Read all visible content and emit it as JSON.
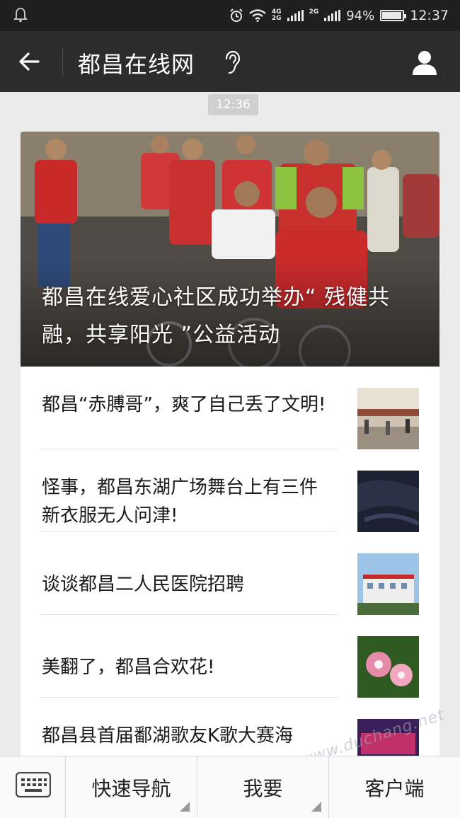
{
  "status_bar": {
    "network_top": "4G",
    "network_bottom": "2G",
    "network2": "2G",
    "battery_percent": "94%",
    "battery_level": 0.94,
    "time": "12:37",
    "icons": [
      "notification-bell-icon",
      "alarm-icon",
      "wifi-icon",
      "signal-icon",
      "battery-icon"
    ]
  },
  "header": {
    "title": "都昌在线网",
    "back_icon": "back-arrow-icon",
    "ear_icon": "ear-icon",
    "profile_icon": "profile-icon"
  },
  "timestamp": "12:36",
  "hero": {
    "title": "都昌在线爱心社区成功举办“ 残健共融，共享阳光 ”公益活动"
  },
  "articles": [
    {
      "title": "都昌“赤膊哥”，爽了自己丢了文明!"
    },
    {
      "title": "怪事，都昌东湖广场舞台上有三件新衣服无人问津!"
    },
    {
      "title": "谈谈都昌二人民医院招聘"
    },
    {
      "title": "美翻了，都昌合欢花!"
    },
    {
      "title": "都昌县首届鄱湖歌友K歌大赛海"
    }
  ],
  "bottom_menu": {
    "keyboard_icon": "keyboard-icon",
    "items": [
      "快速导航",
      "我要",
      "客户端"
    ]
  },
  "watermark": "www.duchang.net"
}
